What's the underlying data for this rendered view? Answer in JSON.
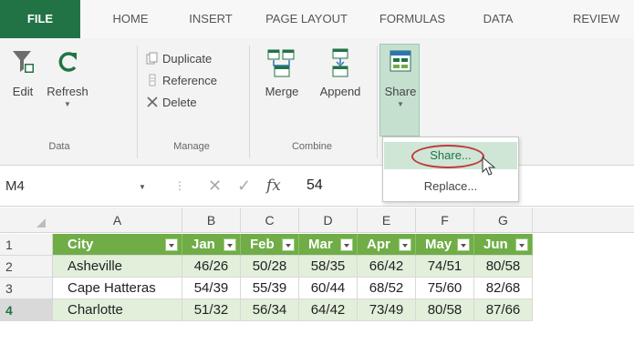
{
  "tabs": {
    "file": "FILE",
    "home": "HOME",
    "insert": "INSERT",
    "page_layout": "PAGE LAYOUT",
    "formulas": "FORMULAS",
    "data": "DATA",
    "review": "REVIEW"
  },
  "ribbon": {
    "edit": "Edit",
    "refresh": "Refresh",
    "duplicate": "Duplicate",
    "reference": "Reference",
    "delete": "Delete",
    "merge": "Merge",
    "append": "Append",
    "share": "Share",
    "groups": {
      "data": "Data",
      "manage": "Manage",
      "combine": "Combine"
    }
  },
  "dropdown": {
    "share": "Share...",
    "replace": "Replace..."
  },
  "formula_bar": {
    "name_box": "M4",
    "fx": "fx",
    "value": "54"
  },
  "grid": {
    "columns": [
      "A",
      "B",
      "C",
      "D",
      "E",
      "F",
      "G"
    ],
    "header": [
      "City",
      "Jan",
      "Feb",
      "Mar",
      "Apr",
      "May",
      "Jun"
    ],
    "rows": [
      {
        "num": "1"
      },
      {
        "num": "2",
        "cells": [
          "Asheville",
          "46/26",
          "50/28",
          "58/35",
          "66/42",
          "74/51",
          "80/58"
        ]
      },
      {
        "num": "3",
        "cells": [
          "Cape Hatteras",
          "54/39",
          "55/39",
          "60/44",
          "68/52",
          "75/60",
          "82/68"
        ]
      },
      {
        "num": "4",
        "cells": [
          "Charlotte",
          "51/32",
          "56/34",
          "64/42",
          "73/49",
          "80/58",
          "87/66"
        ]
      }
    ]
  },
  "colors": {
    "excel_green": "#217346",
    "table_header": "#70ad47",
    "band_row": "#e2efda",
    "highlight_ring": "#c0393b"
  }
}
